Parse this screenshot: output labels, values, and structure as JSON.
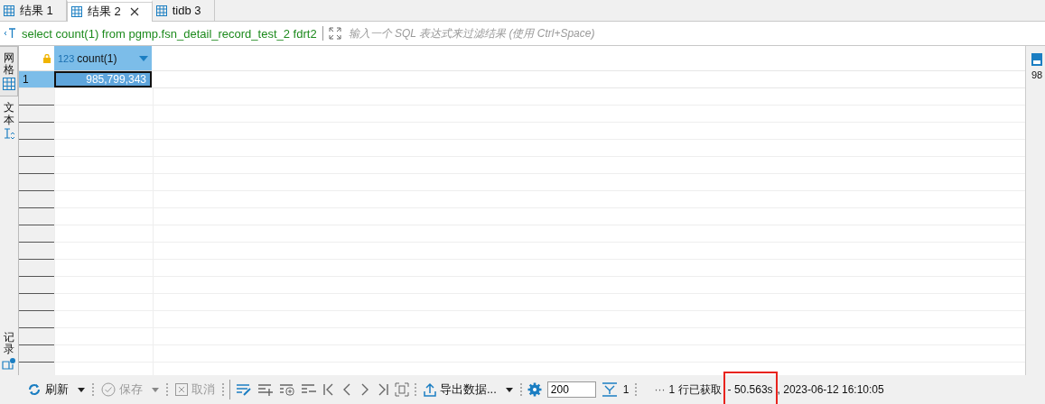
{
  "tabs": [
    {
      "label": "结果 1",
      "selected": false,
      "closable": false
    },
    {
      "label": "结果 2",
      "selected": true,
      "closable": true
    },
    {
      "label": "tidb 3",
      "selected": false,
      "closable": false
    }
  ],
  "filter": {
    "query": "select count(1) from pgmp.fsn_detail_record_test_2 fdrt2",
    "placeholder": "输入一个 SQL 表达式来过滤结果 (使用 Ctrl+Space)"
  },
  "side_tabs": [
    {
      "label": "网格",
      "kind": "grid",
      "selected": true
    },
    {
      "label": "文本",
      "kind": "text",
      "selected": false
    }
  ],
  "side_bottom_tab": {
    "label": "记录"
  },
  "grid": {
    "columns": [
      {
        "type_badge": "123",
        "name": "count(1)",
        "selected": true
      }
    ],
    "rows": [
      {
        "number": "1",
        "selected": true,
        "cells": [
          "985,799,343"
        ]
      }
    ]
  },
  "right_panel": {
    "value": "98"
  },
  "toolbar": {
    "actions": [
      {
        "kind": "refresh",
        "label": "刷新",
        "disabled": false,
        "dropdown": true
      },
      {
        "kind": "save",
        "label": "保存",
        "disabled": true,
        "dropdown": true
      },
      {
        "kind": "cancel",
        "label": "取消",
        "disabled": true,
        "dropdown": false
      }
    ],
    "icon_buttons": [
      {
        "kind": "edit"
      },
      {
        "kind": "add"
      },
      {
        "kind": "copy"
      },
      {
        "kind": "delete"
      },
      {
        "kind": "first"
      },
      {
        "kind": "prev"
      },
      {
        "kind": "next"
      },
      {
        "kind": "last"
      },
      {
        "kind": "frame"
      }
    ],
    "export": {
      "label": "导出数据..."
    },
    "fetch_size": "200",
    "fetch_count": "1",
    "more": "···"
  },
  "status": [
    {
      "text": "1 行已获取",
      "highlighted": false
    },
    {
      "text": "- 50.563s",
      "highlighted": true
    },
    {
      "text": ", 2023-06-12 16:10:05",
      "highlighted": false
    }
  ]
}
